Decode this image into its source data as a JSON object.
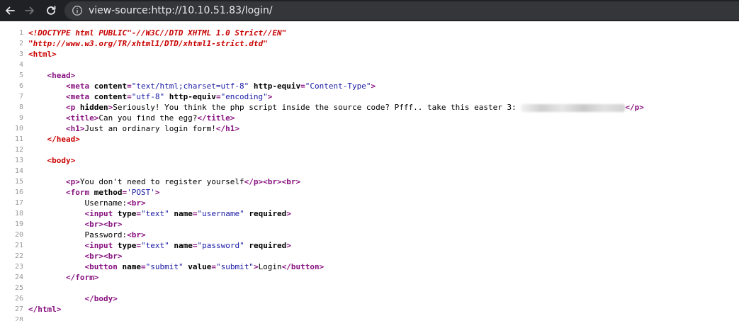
{
  "browser": {
    "url": "view-source:http://10.10.51.83/login/",
    "icons": [
      "back-arrow-icon",
      "forward-arrow-icon",
      "reload-icon",
      "info-icon"
    ]
  },
  "source": {
    "lines": [
      {
        "n": "1",
        "parts": [
          {
            "c": "doctype",
            "t": "<!DOCTYPE html PUBLIC\"-//W3C//DTD XHTML 1.0 Strict//EN\""
          }
        ]
      },
      {
        "n": "2",
        "parts": [
          {
            "c": "doctype",
            "t": "\"http://www.w3.org/TR/xhtml1/DTD/xhtml1-strict.dtd\""
          }
        ]
      },
      {
        "n": "3",
        "parts": [
          {
            "c": "head-tag",
            "t": "<html>"
          }
        ]
      },
      {
        "n": "4",
        "parts": []
      },
      {
        "n": "5",
        "parts": [
          {
            "c": "txt",
            "t": "    "
          },
          {
            "c": "tag",
            "t": "<head>"
          }
        ]
      },
      {
        "n": "6",
        "parts": [
          {
            "c": "txt",
            "t": "        "
          },
          {
            "c": "tag",
            "t": "<meta "
          },
          {
            "c": "attr",
            "t": "content"
          },
          {
            "c": "tag",
            "t": "="
          },
          {
            "c": "val",
            "t": "\"text/html;charset=utf-8\""
          },
          {
            "c": "attr",
            "t": " http-equiv"
          },
          {
            "c": "tag",
            "t": "="
          },
          {
            "c": "val",
            "t": "\"Content-Type\""
          },
          {
            "c": "tag",
            "t": ">"
          }
        ]
      },
      {
        "n": "7",
        "parts": [
          {
            "c": "txt",
            "t": "        "
          },
          {
            "c": "tag",
            "t": "<meta "
          },
          {
            "c": "attr",
            "t": "content"
          },
          {
            "c": "tag",
            "t": "="
          },
          {
            "c": "val",
            "t": "\"utf-8\""
          },
          {
            "c": "attr",
            "t": " http-equiv"
          },
          {
            "c": "tag",
            "t": "="
          },
          {
            "c": "val",
            "t": "\"encoding\""
          },
          {
            "c": "tag",
            "t": ">"
          }
        ]
      },
      {
        "n": "8",
        "parts": [
          {
            "c": "txt",
            "t": "        "
          },
          {
            "c": "tag",
            "t": "<p "
          },
          {
            "c": "attr",
            "t": "hidden"
          },
          {
            "c": "tag",
            "t": ">"
          },
          {
            "c": "txt",
            "t": "Seriously! You think the php script inside the source code? Pfff.. take this easter 3: "
          },
          {
            "c": "redacted",
            "t": ""
          },
          {
            "c": "tag",
            "t": "</p>"
          }
        ]
      },
      {
        "n": "9",
        "parts": [
          {
            "c": "txt",
            "t": "        "
          },
          {
            "c": "tag",
            "t": "<title>"
          },
          {
            "c": "txt",
            "t": "Can you find the egg?"
          },
          {
            "c": "tag",
            "t": "</title>"
          }
        ]
      },
      {
        "n": "10",
        "parts": [
          {
            "c": "txt",
            "t": "        "
          },
          {
            "c": "tag",
            "t": "<h1>"
          },
          {
            "c": "txt",
            "t": "Just an ordinary login form!"
          },
          {
            "c": "tag",
            "t": "</h1>"
          }
        ]
      },
      {
        "n": "11",
        "parts": [
          {
            "c": "txt",
            "t": "    "
          },
          {
            "c": "head-tag",
            "t": "</head>"
          }
        ]
      },
      {
        "n": "12",
        "parts": []
      },
      {
        "n": "13",
        "parts": [
          {
            "c": "txt",
            "t": "    "
          },
          {
            "c": "head-tag",
            "t": "<body>"
          }
        ]
      },
      {
        "n": "14",
        "parts": []
      },
      {
        "n": "15",
        "parts": [
          {
            "c": "txt",
            "t": "        "
          },
          {
            "c": "tag",
            "t": "<p>"
          },
          {
            "c": "txt",
            "t": "You don't need to register yourself"
          },
          {
            "c": "tag",
            "t": "</p><br><br>"
          }
        ]
      },
      {
        "n": "16",
        "parts": [
          {
            "c": "txt",
            "t": "        "
          },
          {
            "c": "tag",
            "t": "<form "
          },
          {
            "c": "attr",
            "t": "method"
          },
          {
            "c": "tag",
            "t": "="
          },
          {
            "c": "val",
            "t": "'POST'"
          },
          {
            "c": "tag",
            "t": ">"
          }
        ]
      },
      {
        "n": "17",
        "parts": [
          {
            "c": "txt",
            "t": "            Username:"
          },
          {
            "c": "tag",
            "t": "<br>"
          }
        ]
      },
      {
        "n": "18",
        "parts": [
          {
            "c": "txt",
            "t": "            "
          },
          {
            "c": "tag",
            "t": "<input "
          },
          {
            "c": "attr",
            "t": "type"
          },
          {
            "c": "tag",
            "t": "="
          },
          {
            "c": "val",
            "t": "\"text\""
          },
          {
            "c": "attr",
            "t": " name"
          },
          {
            "c": "tag",
            "t": "="
          },
          {
            "c": "val",
            "t": "\"username\""
          },
          {
            "c": "attr",
            "t": " required"
          },
          {
            "c": "tag",
            "t": ">"
          }
        ]
      },
      {
        "n": "19",
        "parts": [
          {
            "c": "txt",
            "t": "            "
          },
          {
            "c": "tag",
            "t": "<br><br>"
          }
        ]
      },
      {
        "n": "20",
        "parts": [
          {
            "c": "txt",
            "t": "            Password:"
          },
          {
            "c": "tag",
            "t": "<br>"
          }
        ]
      },
      {
        "n": "21",
        "parts": [
          {
            "c": "txt",
            "t": "            "
          },
          {
            "c": "tag",
            "t": "<input "
          },
          {
            "c": "attr",
            "t": "type"
          },
          {
            "c": "tag",
            "t": "="
          },
          {
            "c": "val",
            "t": "\"text\""
          },
          {
            "c": "attr",
            "t": " name"
          },
          {
            "c": "tag",
            "t": "="
          },
          {
            "c": "val",
            "t": "\"password\""
          },
          {
            "c": "attr",
            "t": " required"
          },
          {
            "c": "tag",
            "t": ">"
          }
        ]
      },
      {
        "n": "22",
        "parts": [
          {
            "c": "txt",
            "t": "            "
          },
          {
            "c": "tag",
            "t": "<br><br>"
          }
        ]
      },
      {
        "n": "23",
        "parts": [
          {
            "c": "txt",
            "t": "            "
          },
          {
            "c": "tag",
            "t": "<button "
          },
          {
            "c": "attr",
            "t": "name"
          },
          {
            "c": "tag",
            "t": "="
          },
          {
            "c": "val",
            "t": "\"submit\""
          },
          {
            "c": "attr",
            "t": " value"
          },
          {
            "c": "tag",
            "t": "="
          },
          {
            "c": "val",
            "t": "\"submit\""
          },
          {
            "c": "tag",
            "t": ">"
          },
          {
            "c": "txt",
            "t": "Login"
          },
          {
            "c": "tag",
            "t": "</button>"
          }
        ]
      },
      {
        "n": "24",
        "parts": [
          {
            "c": "txt",
            "t": "        "
          },
          {
            "c": "tag",
            "t": "</form>"
          }
        ]
      },
      {
        "n": "25",
        "parts": []
      },
      {
        "n": "26",
        "parts": [
          {
            "c": "txt",
            "t": "            "
          },
          {
            "c": "tag",
            "t": "</body>"
          }
        ]
      },
      {
        "n": "27",
        "parts": [
          {
            "c": "tag",
            "t": "</html>"
          }
        ]
      },
      {
        "n": "28",
        "parts": []
      }
    ]
  }
}
